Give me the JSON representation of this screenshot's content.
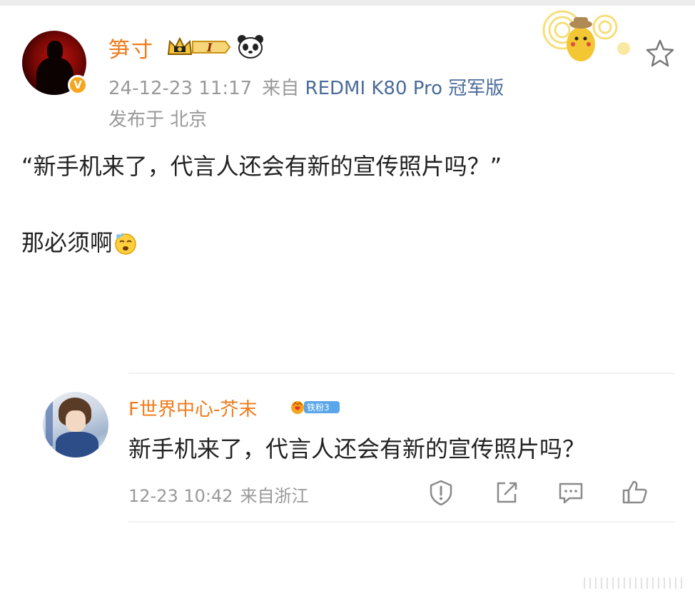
{
  "post": {
    "author": {
      "name": "笋寸",
      "verified_badge": "V",
      "vip_level": "I"
    },
    "timestamp": "24-12-23 11:17",
    "source_prefix": "来自",
    "device": "REDMI K80 Pro 冠军版",
    "location_line": "发布于 北京",
    "quote_text": "“新手机来了，代言人还会有新的宣传照片吗？”",
    "reply_text": "那必须啊"
  },
  "quoted_comment": {
    "author": "F世界中心-芥末",
    "fan_badge_label": "铁粉3",
    "text": "新手机来了，代言人还会有新的宣传照片吗？",
    "timestamp": "12-23 10:42",
    "source": "来自浙江"
  },
  "icons": {
    "favorite": "star-icon",
    "report": "exclamation-shield-icon",
    "share": "share-icon",
    "comment": "comment-icon",
    "like": "thumbs-up-icon"
  },
  "colors": {
    "username": "#f07a1a",
    "device_link": "#4a6b99",
    "meta_gray": "#999999",
    "verified_badge": "#f7a51c"
  }
}
